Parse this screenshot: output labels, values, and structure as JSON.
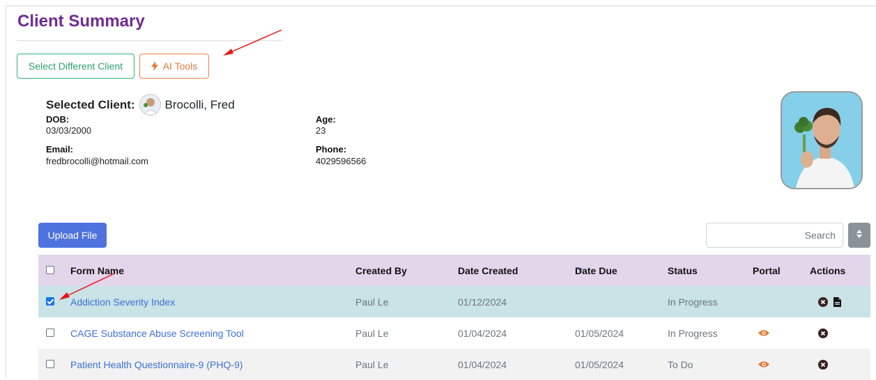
{
  "page": {
    "title": "Client Summary"
  },
  "toolbar": {
    "select_client_label": "Select Different Client",
    "ai_tools_label": "AI Tools"
  },
  "client": {
    "selected_label": "Selected Client:",
    "name": "Brocolli, Fred",
    "dob_label": "DOB:",
    "dob": "03/03/2000",
    "age_label": "Age:",
    "age": "23",
    "email_label": "Email:",
    "email": "fredbrocolli@hotmail.com",
    "phone_label": "Phone:",
    "phone": "4029596566"
  },
  "files": {
    "upload_label": "Upload File",
    "search_placeholder": "Search",
    "columns": {
      "form_name": "Form Name",
      "created_by": "Created By",
      "date_created": "Date Created",
      "date_due": "Date Due",
      "status": "Status",
      "portal": "Portal",
      "actions": "Actions"
    },
    "rows": [
      {
        "form_name": "Addiction Severity Index",
        "created_by": "Paul Le",
        "date_created": "01/12/2024",
        "date_due": "",
        "status": "In Progress",
        "checked": true,
        "portal_icon": "",
        "action_icons": [
          "times-circle-icon",
          "file-icon"
        ]
      },
      {
        "form_name": "CAGE Substance Abuse Screening Tool",
        "created_by": "Paul Le",
        "date_created": "01/04/2024",
        "date_due": "01/05/2024",
        "status": "In Progress",
        "checked": false,
        "portal_icon": "eye-icon",
        "action_icons": [
          "times-circle-icon"
        ]
      },
      {
        "form_name": "Patient Health Questionnaire-9 (PHQ-9)",
        "created_by": "Paul Le",
        "date_created": "01/04/2024",
        "date_due": "01/05/2024",
        "status": "To Do",
        "checked": false,
        "portal_icon": "eye-icon",
        "action_icons": [
          "times-circle-icon"
        ]
      }
    ]
  },
  "colors": {
    "title": "#6f2c91",
    "primary": "#4e73df",
    "success_outline": "#2fb47c",
    "warning_outline": "#e8844a",
    "header_row": "#e3d5ea",
    "selected_row": "#c9e3e6",
    "annotation_arrow": "#e8161a"
  }
}
